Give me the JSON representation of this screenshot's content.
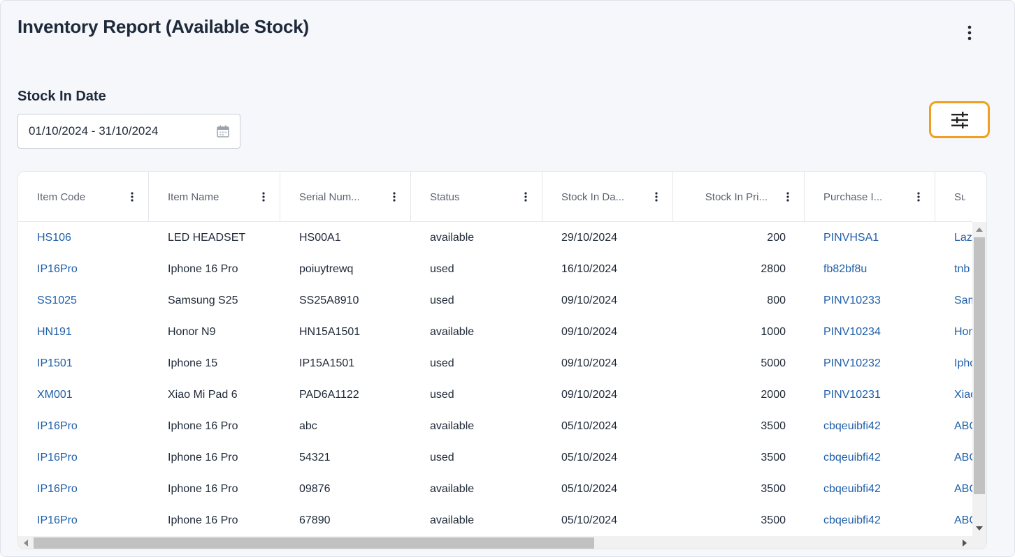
{
  "page": {
    "title": "Inventory Report (Available Stock)",
    "more_icon": "more-vertical-icon"
  },
  "filters": {
    "stock_in_date_label": "Stock In Date",
    "date_range_value": "01/10/2024 - 31/10/2024",
    "calendar_icon": "calendar-icon",
    "filter_button_icon": "tune-sliders-icon"
  },
  "colors": {
    "link": "#1f5fa8",
    "accent_outline": "#f0a020",
    "title": "#1e2939"
  },
  "table": {
    "columns": [
      {
        "label": "Item Code"
      },
      {
        "label": "Item Name"
      },
      {
        "label": "Serial Num..."
      },
      {
        "label": "Status"
      },
      {
        "label": "Stock In Da..."
      },
      {
        "label": "Stock In Pri..."
      },
      {
        "label": "Purchase I..."
      },
      {
        "label": "Sup"
      }
    ],
    "rows": [
      {
        "item_code": "HS106",
        "item_name": "LED HEADSET",
        "serial": "HS00A1",
        "status": "available",
        "stock_in_date": "29/10/2024",
        "price": "200",
        "purchase": "PINVHSA1",
        "supplier": "Laz"
      },
      {
        "item_code": "IP16Pro",
        "item_name": "Iphone 16 Pro",
        "serial": "poiuytrewq",
        "status": "used",
        "stock_in_date": "16/10/2024",
        "price": "2800",
        "purchase": "fb82bf8u",
        "supplier": "tnb"
      },
      {
        "item_code": "SS1025",
        "item_name": "Samsung S25",
        "serial": "SS25A8910",
        "status": "used",
        "stock_in_date": "09/10/2024",
        "price": "800",
        "purchase": "PINV10233",
        "supplier": "Sam"
      },
      {
        "item_code": "HN191",
        "item_name": "Honor N9",
        "serial": "HN15A1501",
        "status": "available",
        "stock_in_date": "09/10/2024",
        "price": "1000",
        "purchase": "PINV10234",
        "supplier": "Hon"
      },
      {
        "item_code": "IP1501",
        "item_name": "Iphone 15",
        "serial": "IP15A1501",
        "status": "used",
        "stock_in_date": "09/10/2024",
        "price": "5000",
        "purchase": "PINV10232",
        "supplier": "Ipho"
      },
      {
        "item_code": "XM001",
        "item_name": "Xiao Mi Pad 6",
        "serial": "PAD6A1122",
        "status": "used",
        "stock_in_date": "09/10/2024",
        "price": "2000",
        "purchase": "PINV10231",
        "supplier": "Xiao"
      },
      {
        "item_code": "IP16Pro",
        "item_name": "Iphone 16 Pro",
        "serial": "abc",
        "status": "available",
        "stock_in_date": "05/10/2024",
        "price": "3500",
        "purchase": "cbqeuibfi42",
        "supplier": "ABC"
      },
      {
        "item_code": "IP16Pro",
        "item_name": "Iphone 16 Pro",
        "serial": "54321",
        "status": "used",
        "stock_in_date": "05/10/2024",
        "price": "3500",
        "purchase": "cbqeuibfi42",
        "supplier": "ABC"
      },
      {
        "item_code": "IP16Pro",
        "item_name": "Iphone 16 Pro",
        "serial": "09876",
        "status": "available",
        "stock_in_date": "05/10/2024",
        "price": "3500",
        "purchase": "cbqeuibfi42",
        "supplier": "ABC"
      },
      {
        "item_code": "IP16Pro",
        "item_name": "Iphone 16 Pro",
        "serial": "67890",
        "status": "available",
        "stock_in_date": "05/10/2024",
        "price": "3500",
        "purchase": "cbqeuibfi42",
        "supplier": "ABC"
      }
    ]
  }
}
